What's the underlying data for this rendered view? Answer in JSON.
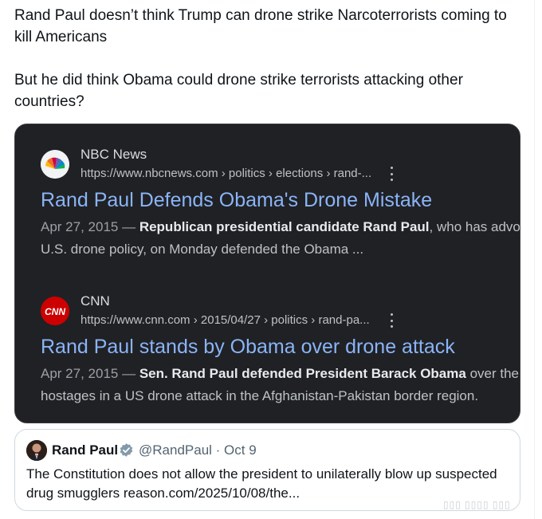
{
  "tweet": {
    "line1": "Rand Paul doesn’t think Trump can drone strike Narcoterrorists coming to kill Americans",
    "line2": "But he did think Obama could drone strike terrorists attacking other countries?"
  },
  "results": [
    {
      "icon": "nbc-peacock-icon",
      "site": "NBC News",
      "url": "https://www.nbcnews.com › politics › elections › rand-...",
      "title": "Rand Paul Defends Obama's Drone Mistake",
      "date": "Apr 27, 2015 —",
      "snippet_bold": "Republican presidential candidate Rand Paul",
      "snippet_rest": ", who has advocated",
      "snippet_line2": "U.S. drone policy, on Monday defended the Obama ..."
    },
    {
      "icon": "cnn-logo-icon",
      "site": "CNN",
      "url": "https://www.cnn.com › 2015/04/27 › politics › rand-pa...",
      "title": "Rand Paul stands by Obama over drone attack",
      "date": "Apr 27, 2015 —",
      "snippet_bold": "Sen. Rand Paul defended President Barack Obama",
      "snippet_rest": " over the accidental",
      "snippet_line2": "hostages in a US drone attack in the Afghanistan-Pakistan border region."
    }
  ],
  "quote": {
    "name": "Rand Paul",
    "handle_date": "@RandPaul · Oct 9",
    "text": "The Constitution does not allow the president to unilaterally blow up suspected drug smugglers reason.com/2025/10/08/the..."
  },
  "colors": {
    "link_blue": "#8ab4f8",
    "card_bg": "#202124",
    "verified": "#829aab"
  }
}
